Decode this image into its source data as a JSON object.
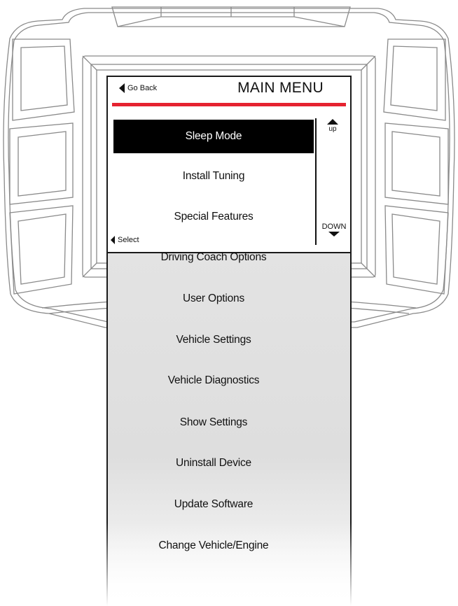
{
  "header": {
    "back_label": "Go Back",
    "title": "MAIN MENU"
  },
  "scroll": {
    "up_label": "up",
    "down_label": "DOWN"
  },
  "select_label": "Select",
  "menu": {
    "items": [
      {
        "label": "Sleep Mode",
        "selected": true
      },
      {
        "label": "Install Tuning"
      },
      {
        "label": "Special Features"
      },
      {
        "label": "Driving Coach Options"
      },
      {
        "label": "User Options"
      },
      {
        "label": "Vehicle Settings"
      },
      {
        "label": "Vehicle Diagnostics"
      },
      {
        "label": "Show Settings"
      },
      {
        "label": "Uninstall Device"
      },
      {
        "label": "Update Software"
      },
      {
        "label": "Change Vehicle/Engine"
      }
    ]
  },
  "colors": {
    "accent_line": "#e52330",
    "selected_bg": "#000000",
    "selected_text": "#ffffff"
  }
}
